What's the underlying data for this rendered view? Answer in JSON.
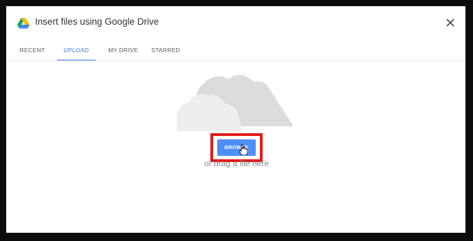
{
  "dialog": {
    "title": "Insert files using Google Drive",
    "close_label": "×"
  },
  "tabs": [
    {
      "label": "RECENT",
      "active": false
    },
    {
      "label": "UPLOAD",
      "active": true
    },
    {
      "label": "MY DRIVE",
      "active": false
    },
    {
      "label": "STARRED",
      "active": false
    }
  ],
  "upload": {
    "browse_label": "BROWSE",
    "drag_text": "or drag a file here"
  },
  "icons": {
    "logo": "google-drive-icon",
    "close": "close-icon",
    "illustration": "cloud-icon",
    "cursor": "hand-pointer-cursor-icon"
  },
  "colors": {
    "accent": "#3b78e7",
    "button": "#4d8ff5",
    "highlight": "#e21b1b",
    "cloud": "#d9dadc",
    "frame": "#0c0c0c"
  }
}
